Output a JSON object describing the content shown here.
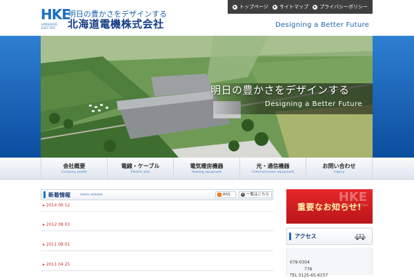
{
  "brand": {
    "logo_mark": "HKE",
    "logo_sub": "HOKKAIDO ELECTRIC",
    "tagline": "明日の豊かさをデザインする",
    "company_name": "北海道電機株式会社",
    "accent_blue": "#1d6fc2",
    "accent_green": "#35a843"
  },
  "topnav": [
    {
      "label": "トップページ"
    },
    {
      "label": "サイトマップ"
    },
    {
      "label": "プライバシーポリシー"
    }
  ],
  "slogan_en": "Designing a Better Future",
  "hero": {
    "title_jp": "明日の豊かさをデザインする",
    "title_en": "Designing a Better Future"
  },
  "gnav": [
    {
      "jp": "会社概要",
      "en": "Company profile"
    },
    {
      "jp": "電線・ケーブル",
      "en": "Electric wire"
    },
    {
      "jp": "電気暖房機器",
      "en": "Heating equipment"
    },
    {
      "jp": "光・通信機器",
      "en": "Communication equipment"
    },
    {
      "jp": "お問い合わせ",
      "en": "Inquiry"
    }
  ],
  "news": {
    "title": "新着情報",
    "subtitle": "news release",
    "rss_label": "RSS",
    "list_label": "一覧はこちら",
    "items": [
      {
        "date": "2014 06 12"
      },
      {
        "date": "2012 08 03"
      },
      {
        "date": "2011 08 01"
      },
      {
        "date": "2011 04 25"
      }
    ]
  },
  "sidebar": {
    "notice_label": "重要なお知らせ!",
    "notice_watermark": "HKE",
    "notice_watermark_sub": "HOKKAIDO ELECTRIC",
    "access_label": "アクセス",
    "address_line1": "079-0304",
    "address_line2": "776",
    "address_line3": "TEL 0125-65-6157"
  }
}
